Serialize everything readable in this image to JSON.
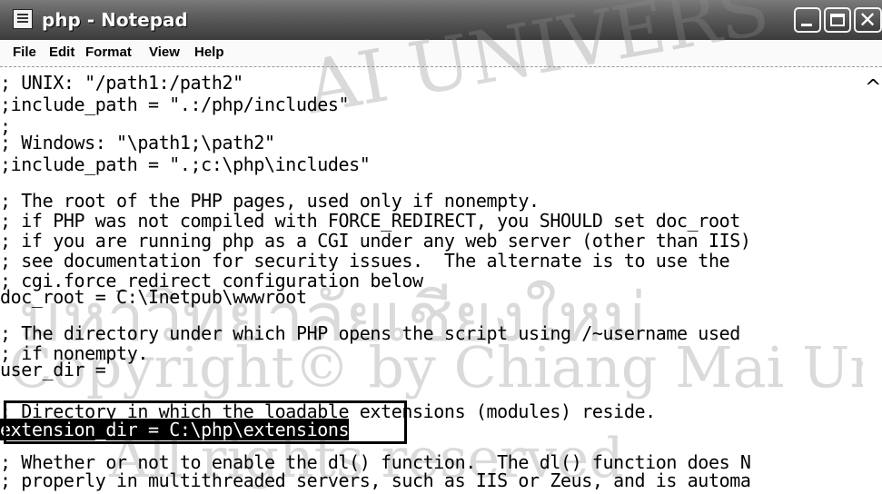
{
  "window": {
    "title": "php - Notepad",
    "icon": "notepad-icon",
    "controls": {
      "minimize_icon": "minimize-icon",
      "maximize_icon": "maximize-icon",
      "close_icon": "close-icon"
    }
  },
  "menubar": {
    "items": [
      {
        "label": "File"
      },
      {
        "label": "Edit"
      },
      {
        "label": "Format"
      },
      {
        "label": "View"
      },
      {
        "label": "Help"
      }
    ]
  },
  "editor": {
    "lines": [
      "; UNIX: \"/path1:/path2\"",
      ";include_path = \".:/php/includes\"",
      ";",
      "; Windows: \"\\path1;\\path2\"",
      ";include_path = \".;c:\\php\\includes\"",
      "",
      "; The root of the PHP pages, used only if nonempty.",
      "; if PHP was not compiled with FORCE_REDIRECT, you SHOULD set doc_root",
      "; if you are running php as a CGI under any web server (other than IIS)",
      "; see documentation for security issues.  The alternate is to use the",
      "; cgi.force_redirect configuration below",
      "doc_root = C:\\Inetpub\\wwwroot",
      "",
      "; The directory under which PHP opens the script using /~username used",
      "; if nonempty.",
      "user_dir =",
      "",
      "; Directory in which the loadable extensions (modules) reside.",
      "extension_dir = C:\\php\\extensions",
      "",
      "; Whether or not to enable the dl() function.  The dl() function does N",
      "; properly in multithreaded servers, such as IIS or Zeus, and is automa"
    ],
    "selected_text": "extension_dir = C:\\php\\extensions"
  },
  "scrollbar": {
    "up_icon": "scroll-up-icon"
  },
  "watermark": {
    "line1": "AI UNIVERS",
    "line2": "มหาวิทยาลัยเชียงใหม่",
    "line3": "Copyright© by Chiang Mai Uni",
    "line4": "All rights reserved"
  }
}
